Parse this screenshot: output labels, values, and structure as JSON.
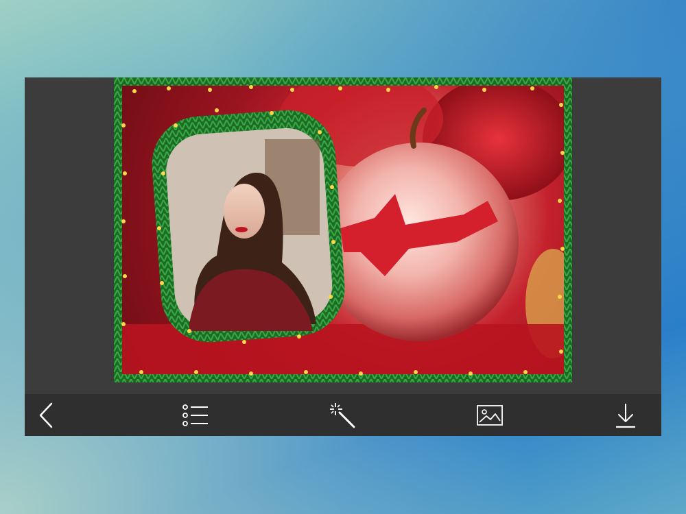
{
  "colors": {
    "toolbar_bg": "#2f2f2f",
    "canvas_bg": "#3c3c3c",
    "icon": "#ffffff",
    "frame_green": "#1f7a2a",
    "star_gold": "#ffd84a"
  },
  "toolbar": {
    "items": [
      {
        "name": "back-button",
        "icon": "chevron-left-icon"
      },
      {
        "name": "frames-list-button",
        "icon": "list-icon"
      },
      {
        "name": "effects-button",
        "icon": "magic-wand-icon"
      },
      {
        "name": "gallery-button",
        "icon": "image-icon"
      },
      {
        "name": "download-button",
        "icon": "download-icon"
      }
    ]
  },
  "photo": {
    "content": "christmas-photo-frame"
  }
}
